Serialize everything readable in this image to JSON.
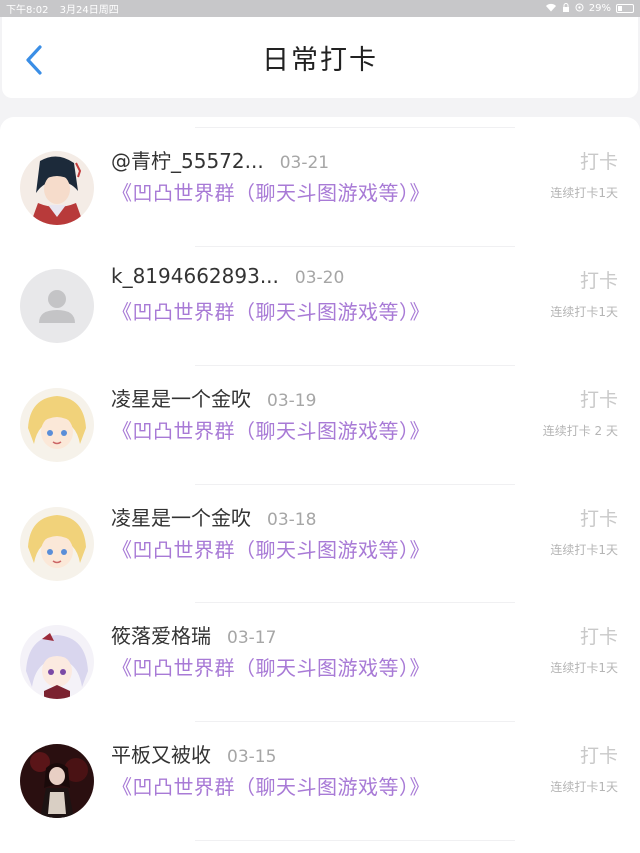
{
  "status_bar": {
    "time": "下午8:02",
    "date": "3月24日周四",
    "battery": "29%"
  },
  "header": {
    "title": "日常打卡",
    "back_icon": "chevron-left-icon"
  },
  "colors": {
    "accent": "#3a8ee6",
    "group_link": "#a87ad6",
    "muted": "#c9c9c9"
  },
  "entries": [
    {
      "username": "@青柠_55572...",
      "date": "03-21",
      "group": "《凹凸世界群（聊天斗图游戏等）》",
      "action": "打卡",
      "streak": "连续打卡1天",
      "avatar": "anime-boy-avatar"
    },
    {
      "username": "k_8194662893...",
      "date": "03-20",
      "group": "《凹凸世界群（聊天斗图游戏等）》",
      "action": "打卡",
      "streak": "连续打卡1天",
      "avatar": "default-user-avatar"
    },
    {
      "username": "凌星是一个金吹",
      "date": "03-19",
      "group": "《凹凸世界群（聊天斗图游戏等）》",
      "action": "打卡",
      "streak": "连续打卡 2 天",
      "avatar": "blonde-anime-avatar"
    },
    {
      "username": "凌星是一个金吹",
      "date": "03-18",
      "group": "《凹凸世界群（聊天斗图游戏等）》",
      "action": "打卡",
      "streak": "连续打卡1天",
      "avatar": "blonde-anime-avatar"
    },
    {
      "username": "筱落爱格瑞",
      "date": "03-17",
      "group": "《凹凸世界群（聊天斗图游戏等）》",
      "action": "打卡",
      "streak": "连续打卡1天",
      "avatar": "silver-hair-anime-avatar"
    },
    {
      "username": "平板又被收",
      "date": "03-15",
      "group": "《凹凸世界群（聊天斗图游戏等）》",
      "action": "打卡",
      "streak": "连续打卡1天",
      "avatar": "dark-anime-avatar"
    }
  ]
}
